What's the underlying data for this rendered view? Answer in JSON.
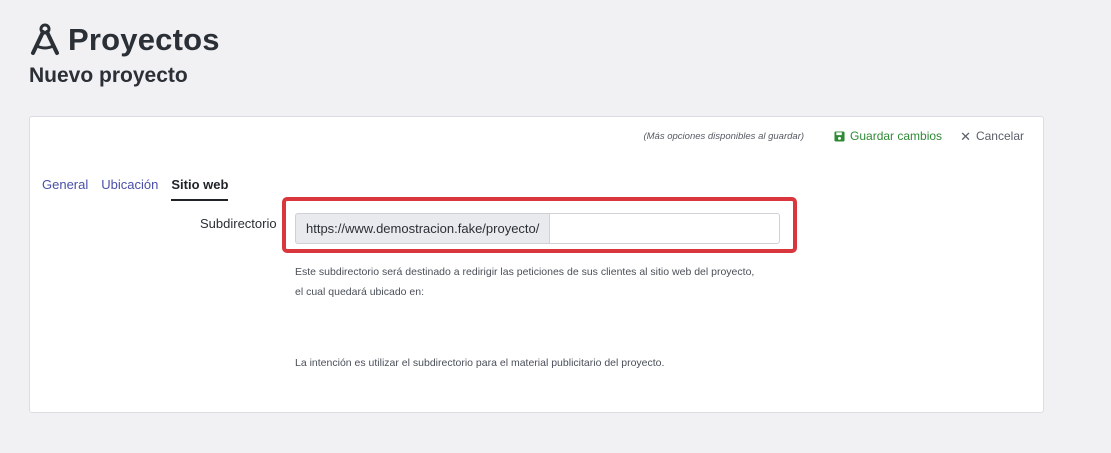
{
  "header": {
    "title": "Proyectos",
    "subtitle": "Nuevo proyecto",
    "icon": "compass-drafting-icon"
  },
  "actions": {
    "hint": "(Más opciones disponibles al guardar)",
    "save_label": "Guardar cambios",
    "cancel_label": "Cancelar"
  },
  "tabs": [
    {
      "label": "General",
      "active": false
    },
    {
      "label": "Ubicación",
      "active": false
    },
    {
      "label": "Sitio web",
      "active": true
    }
  ],
  "form": {
    "subdirectory_label": "Subdirectorio",
    "url_prefix": "https://www.demostracion.fake/proyecto/",
    "subdirectory_value": "",
    "help_line_1": "Este subdirectorio será destinado a redirigir las peticiones de sus clientes al sitio web del proyecto,",
    "help_line_2": "el cual quedará ubicado en:",
    "help_line_3": "La intención es utilizar el subdirectorio para el material publicitario del proyecto."
  },
  "colors": {
    "save": "#2f8a35",
    "tab_link": "#4a4fa8",
    "highlight": "#d9363e"
  }
}
